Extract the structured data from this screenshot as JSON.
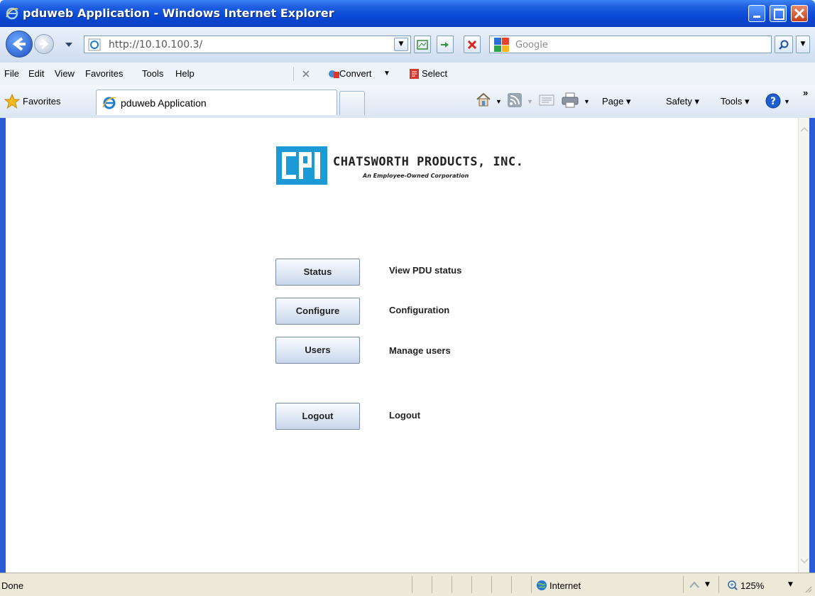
{
  "window": {
    "title": "pduweb Application - Windows Internet Explorer"
  },
  "address_bar": {
    "url": "http://10.10.100.3/",
    "search_placeholder": "Google"
  },
  "menu": {
    "items": [
      "File",
      "Edit",
      "View",
      "Favorites",
      "Tools",
      "Help"
    ],
    "convert_label": "Convert",
    "select_label": "Select"
  },
  "favorites_bar": {
    "favorites_label": "Favorites",
    "tab_label": "pduweb Application",
    "page_label": "Page",
    "safety_label": "Safety",
    "tools_label": "Tools"
  },
  "page": {
    "logo_name": "CHATSWORTH PRODUCTS, INC.",
    "logo_tagline": "An Employee-Owned Corporation",
    "actions": [
      {
        "label": "Status",
        "description": "View PDU status"
      },
      {
        "label": "Configure",
        "description": "Configuration"
      },
      {
        "label": "Users",
        "description": "Manage users"
      },
      {
        "label": "Logout",
        "description": "Logout"
      }
    ]
  },
  "status_bar": {
    "status": "Done",
    "zone": "Internet",
    "zoom": "125%"
  },
  "colors": {
    "titlebar": "#0a49d6",
    "logo_blue": "#1b9ad6",
    "button_face": "#dfe8f5"
  }
}
